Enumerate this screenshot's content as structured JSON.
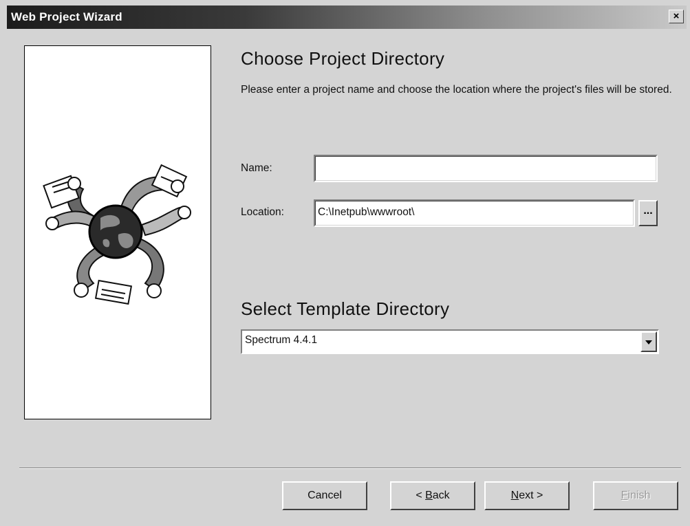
{
  "window": {
    "title": "Web Project Wizard",
    "close_glyph": "×"
  },
  "page": {
    "heading_project": "Choose Project Directory",
    "description": "Please enter a project name and choose the location where the project's files will be stored.",
    "heading_template": "Select Template Directory"
  },
  "form": {
    "name_label": "Name:",
    "name_value": "",
    "location_label": "Location:",
    "location_value": "C:\\Inetpub\\wwwroot\\",
    "browse_label": "...",
    "template_value": "Spectrum 4.4.1"
  },
  "buttons": {
    "cancel": "Cancel",
    "back_prefix": "< ",
    "back_accel": "B",
    "back_rest": "ack",
    "next_accel": "N",
    "next_rest": "ext >",
    "finish_accel": "F",
    "finish_rest": "inish"
  },
  "icons": {
    "wizard_art": "globe-hands-illustration",
    "dropdown": "chevron-down-icon"
  },
  "colors": {
    "dialog_bg": "#d4d4d4",
    "title_bar": "#1c1c1c",
    "disabled_text": "#9a9a9a"
  }
}
